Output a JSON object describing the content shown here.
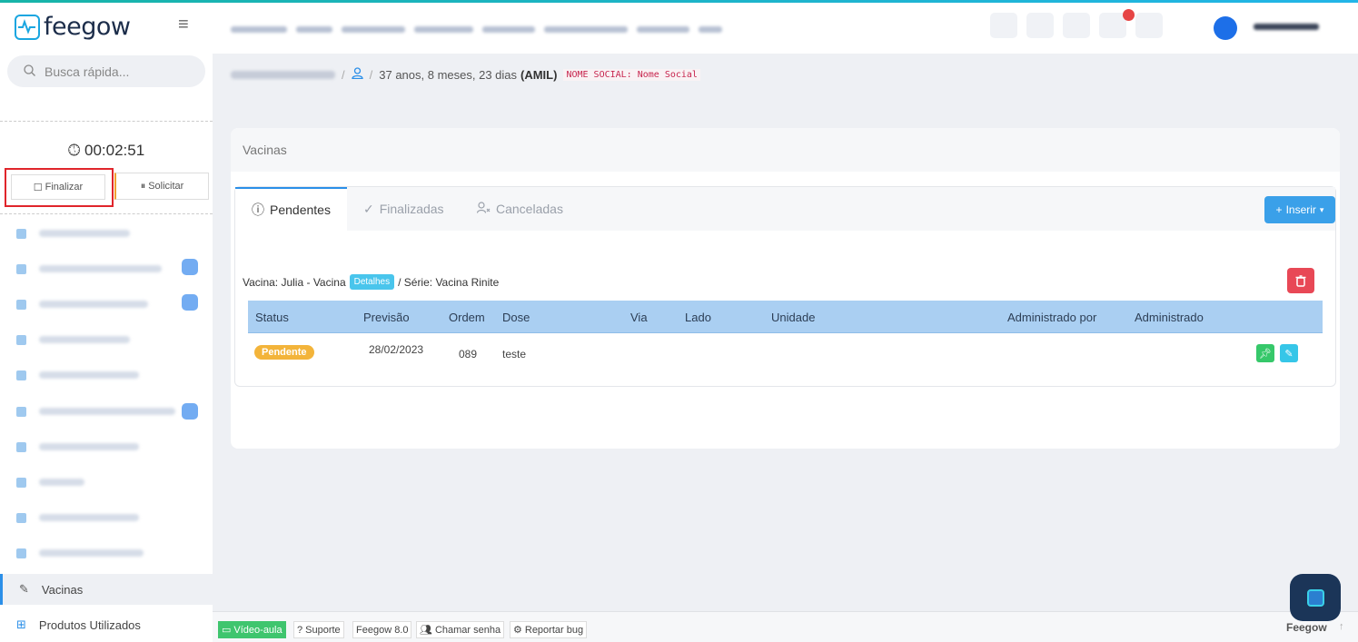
{
  "app": {
    "logo_text": "feegow"
  },
  "search": {
    "placeholder": "Busca rápida..."
  },
  "timer": {
    "value": "00:02:51"
  },
  "session": {
    "finalize_label": "Finalizar",
    "request_label": "Solicitar"
  },
  "sidebar": {
    "active_label": "Vacinas",
    "last_label": "Produtos Utilizados"
  },
  "breadcrumb": {
    "age": "37 anos, 8 meses, 23 dias",
    "plan": "(AMIL)",
    "social_name": "NOME SOCIAL: Nome Social"
  },
  "card": {
    "title": "Vacinas"
  },
  "tabs": {
    "pending": "Pendentes",
    "finished": "Finalizadas",
    "cancelled": "Canceladas"
  },
  "insert_button": "Inserir",
  "vaccine": {
    "prefix": "Vacina: Julia - Vacina",
    "details": "Detalhes",
    "series": "/ Série: Vacina Rinite"
  },
  "table": {
    "headers": [
      "Status",
      "Previsão",
      "Ordem",
      "Dose",
      "Via",
      "Lado",
      "Unidade",
      "Administrado por",
      "Administrado"
    ],
    "row": {
      "status": "Pendente",
      "date": "28/02/2023",
      "order": "089",
      "dose": "teste"
    }
  },
  "footer": {
    "video": "Vídeo-aula",
    "support": "Suporte",
    "version": "Feegow 8.0",
    "call": "Chamar senha",
    "bug": "Reportar bug",
    "brand": "Feegow"
  },
  "colors": {
    "accent": "#2b8fe8",
    "pending": "#f3b43a",
    "danger": "#e84856",
    "highlight": "#e0252b"
  }
}
